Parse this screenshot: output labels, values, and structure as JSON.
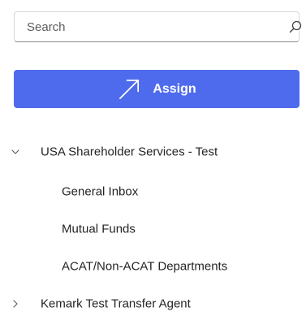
{
  "search": {
    "placeholder": "Search",
    "value": "",
    "icon": "search-icon"
  },
  "assign_button": {
    "label": "Assign",
    "icon": "arrow-up-right-icon",
    "color": "#4f6bed"
  },
  "tree": {
    "groups": [
      {
        "label": "USA Shareholder Services - Test",
        "expanded": true,
        "icon": "chevron-down-icon",
        "children": [
          {
            "label": "General Inbox"
          },
          {
            "label": "Mutual Funds"
          },
          {
            "label": "ACAT/Non-ACAT Departments"
          }
        ]
      },
      {
        "label": "Kemark Test Transfer Agent",
        "expanded": false,
        "icon": "chevron-right-icon",
        "children": []
      }
    ]
  }
}
